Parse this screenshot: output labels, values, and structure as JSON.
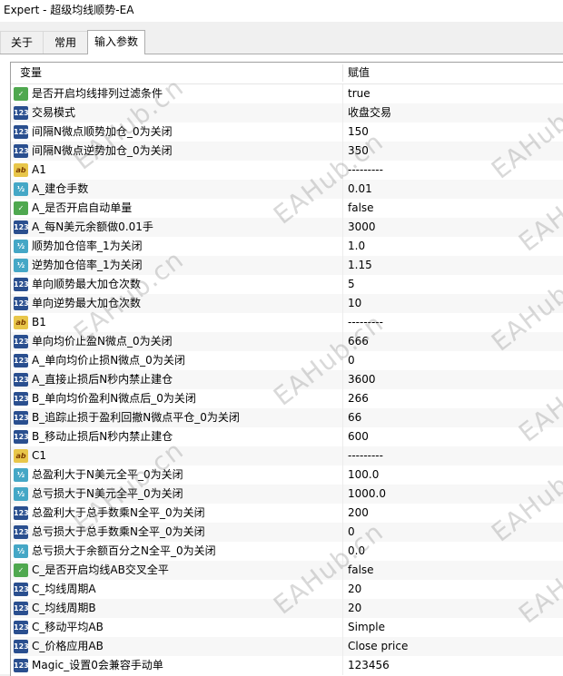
{
  "window": {
    "title": "Expert - 超级均线顺势-EA"
  },
  "tabs": [
    {
      "label": "关于"
    },
    {
      "label": "常用"
    },
    {
      "label": "输入参数"
    }
  ],
  "table": {
    "headers": {
      "name": "变量",
      "value": "赋值"
    },
    "rows": [
      {
        "type": "bool",
        "name": "是否开启均线排列过滤条件",
        "value": "true"
      },
      {
        "type": "int",
        "name": "交易模式",
        "value": "收盘交易"
      },
      {
        "type": "int",
        "name": "间隔N微点顺势加仓_0为关闭",
        "value": "150"
      },
      {
        "type": "int",
        "name": "间隔N微点逆势加仓_0为关闭",
        "value": "350"
      },
      {
        "type": "str",
        "name": "A1",
        "value": "---------"
      },
      {
        "type": "dbl",
        "name": "A_建仓手数",
        "value": "0.01"
      },
      {
        "type": "bool",
        "name": "A_是否开启自动单量",
        "value": "false"
      },
      {
        "type": "int",
        "name": "A_每N美元余额做0.01手",
        "value": "3000"
      },
      {
        "type": "dbl",
        "name": "顺势加仓倍率_1为关闭",
        "value": "1.0"
      },
      {
        "type": "dbl",
        "name": "逆势加仓倍率_1为关闭",
        "value": "1.15"
      },
      {
        "type": "int",
        "name": "单向顺势最大加仓次数",
        "value": "5"
      },
      {
        "type": "int",
        "name": "单向逆势最大加仓次数",
        "value": "10"
      },
      {
        "type": "str",
        "name": "B1",
        "value": "---------"
      },
      {
        "type": "int",
        "name": "单向均价止盈N微点_0为关闭",
        "value": "666"
      },
      {
        "type": "int",
        "name": "A_单向均价止损N微点_0为关闭",
        "value": "0"
      },
      {
        "type": "int",
        "name": "A_直接止损后N秒内禁止建仓",
        "value": "3600"
      },
      {
        "type": "int",
        "name": "B_单向均价盈利N微点后_0为关闭",
        "value": "266"
      },
      {
        "type": "int",
        "name": "B_追踪止损于盈利回撤N微点平仓_0为关闭",
        "value": "66"
      },
      {
        "type": "int",
        "name": "B_移动止损后N秒内禁止建仓",
        "value": "600"
      },
      {
        "type": "str",
        "name": "C1",
        "value": "---------"
      },
      {
        "type": "dbl",
        "name": "总盈利大于N美元全平_0为关闭",
        "value": "100.0"
      },
      {
        "type": "dbl",
        "name": "总亏损大于N美元全平_0为关闭",
        "value": "1000.0"
      },
      {
        "type": "int",
        "name": "总盈利大于总手数乘N全平_0为关闭",
        "value": "200"
      },
      {
        "type": "int",
        "name": "总亏损大于总手数乘N全平_0为关闭",
        "value": "0"
      },
      {
        "type": "dbl",
        "name": "总亏损大于余额百分之N全平_0为关闭",
        "value": "0.0"
      },
      {
        "type": "bool",
        "name": "C_是否开启均线AB交叉全平",
        "value": "false"
      },
      {
        "type": "int",
        "name": "C_均线周期A",
        "value": "20"
      },
      {
        "type": "int",
        "name": "C_均线周期B",
        "value": "20"
      },
      {
        "type": "int",
        "name": "C_移动平均AB",
        "value": "Simple"
      },
      {
        "type": "int",
        "name": "C_价格应用AB",
        "value": "Close price"
      },
      {
        "type": "int",
        "name": "Magic_设置0会兼容手动单",
        "value": "123456"
      }
    ]
  },
  "icons": {
    "int": {
      "glyph": "123",
      "icon": "integer-type-icon"
    },
    "dbl": {
      "glyph": "½",
      "icon": "double-type-icon"
    },
    "bool": {
      "glyph": "✓",
      "icon": "bool-type-icon"
    },
    "str": {
      "glyph": "ab",
      "icon": "string-type-icon"
    }
  },
  "watermark": "EAHub.cn"
}
